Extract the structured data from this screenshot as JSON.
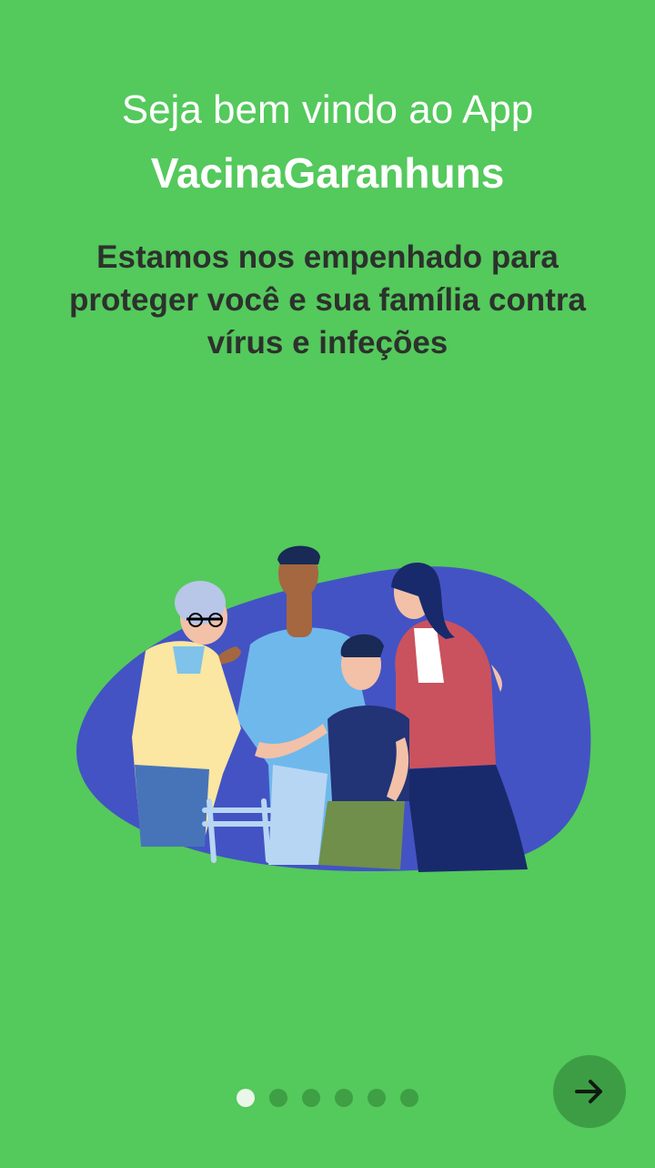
{
  "welcome": {
    "line1": "Seja bem vindo ao App",
    "app_name": "VacinaGaranhuns",
    "description": "Estamos nos empenhado para proteger você e sua família contra vírus e infeções"
  },
  "illustration": {
    "icon": "family-illustration"
  },
  "pager": {
    "total": 6,
    "current": 1
  },
  "next_button": {
    "icon": "arrow-right-icon"
  },
  "colors": {
    "background": "#54c95c",
    "title_text": "#ffffff",
    "body_text": "#2c312c",
    "accent_dark": "#3d9d44",
    "blob": "#4353c4"
  }
}
